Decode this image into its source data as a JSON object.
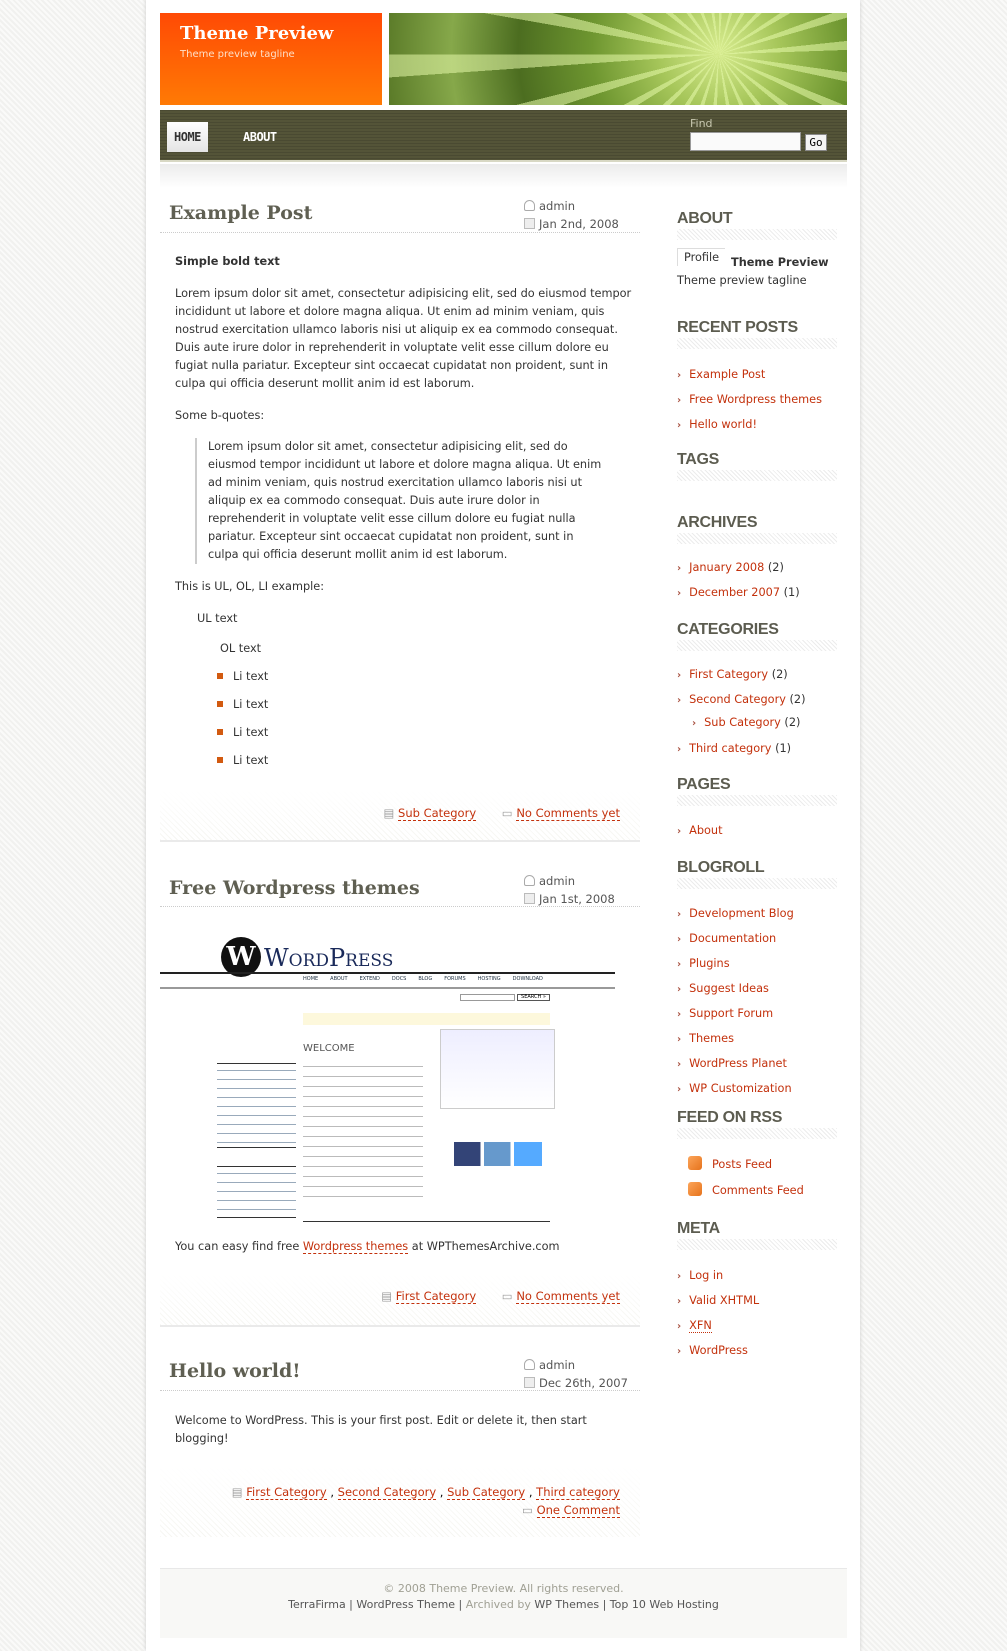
{
  "site": {
    "title": "Theme Preview",
    "tagline": "Theme preview tagline"
  },
  "nav": {
    "items": [
      {
        "label": "HOME",
        "active": true
      },
      {
        "label": "ABOUT"
      }
    ],
    "find_label": "Find",
    "search_value": "",
    "go_label": "Go"
  },
  "colors": {
    "accent": "#ff6a05",
    "link": "#c3310c",
    "nav_bg": "#4e4e35"
  },
  "posts": [
    {
      "title": "Example Post",
      "author": "admin",
      "date": "Jan 2nd, 2008",
      "bold": "Simple bold text",
      "para": "Lorem ipsum dolor sit amet, consectetur adipisicing elit, sed do eiusmod tempor incididunt ut labore et dolore magna aliqua. Ut enim ad minim veniam, quis nostrud exercitation ullamco laboris nisi ut aliquip ex ea commodo consequat. Duis aute irure dolor in reprehenderit in voluptate velit esse cillum dolore eu fugiat nulla pariatur. Excepteur sint occaecat cupidatat non proident, sunt in culpa qui officia deserunt mollit anim id est laborum.",
      "bq_label": "Some b-quotes:",
      "quote": "Lorem ipsum dolor sit amet, consectetur adipisicing elit, sed do eiusmod tempor incididunt ut labore et dolore magna aliqua. Ut enim ad minim veniam, quis nostrud exercitation ullamco laboris nisi ut aliquip ex ea commodo consequat. Duis aute irure dolor in reprehenderit in voluptate velit esse cillum dolore eu fugiat nulla pariatur. Excepteur sint occaecat cupidatat non proident, sunt in culpa qui officia deserunt mollit anim id est laborum.",
      "list_label": "This is UL, OL, LI example:",
      "ul": "UL text",
      "ol": "OL text",
      "li": [
        "Li text",
        "Li text",
        "Li text",
        "Li text"
      ],
      "category": "Sub Category",
      "comments": "No Comments yet"
    },
    {
      "title": "Free Wordpress themes",
      "author": "admin",
      "date": "Jan 1st, 2008",
      "text_before": "You can easy find free ",
      "link": "Wordpress themes",
      "text_after": " at WPThemesArchive.com",
      "image": {
        "logo": "WordPress",
        "nav": [
          "HOME",
          "ABOUT",
          "EXTEND",
          "DOCS",
          "BLOG",
          "FORUMS",
          "HOSTING",
          "DOWNLOAD"
        ],
        "search": "SEARCH »",
        "welcome": "WELCOME"
      },
      "category": "First Category",
      "comments": "No Comments yet"
    },
    {
      "title": "Hello world!",
      "author": "admin",
      "date": "Dec 26th, 2007",
      "text": "Welcome to WordPress. This is your first post. Edit or delete it, then start blogging!",
      "categories": [
        "First Category",
        "Second Category",
        "Sub Category",
        "Third category"
      ],
      "comments": "One Comment"
    }
  ],
  "sidebar": {
    "about": {
      "heading": "ABOUT",
      "tab": "Profile",
      "name": "Theme Preview",
      "tagline": "Theme preview tagline"
    },
    "recent": {
      "heading": "RECENT POSTS",
      "items": [
        "Example Post",
        "Free Wordpress themes",
        "Hello world!"
      ]
    },
    "tags": {
      "heading": "TAGS"
    },
    "archives": {
      "heading": "ARCHIVES",
      "items": [
        {
          "label": "January 2008",
          "count": "(2)"
        },
        {
          "label": "December 2007",
          "count": "(1)"
        }
      ]
    },
    "categories": {
      "heading": "CATEGORIES",
      "items": [
        {
          "label": "First Category",
          "count": "(2)"
        },
        {
          "label": "Second Category",
          "count": "(2)"
        },
        {
          "label": "Sub Category",
          "count": "(2)"
        },
        {
          "label": "Third category",
          "count": "(1)"
        }
      ]
    },
    "pages": {
      "heading": "PAGES",
      "items": [
        "About"
      ]
    },
    "blogroll": {
      "heading": "BLOGROLL",
      "items": [
        "Development Blog",
        "Documentation",
        "Plugins",
        "Suggest Ideas",
        "Support Forum",
        "Themes",
        "WordPress Planet",
        "WP Customization"
      ]
    },
    "feed": {
      "heading": "FEED ON RSS",
      "items": [
        "Posts Feed",
        "Comments Feed"
      ]
    },
    "meta": {
      "heading": "META",
      "items": [
        "Log in",
        "Valid XHTML",
        "XFN",
        "WordPress"
      ]
    }
  },
  "footer": {
    "copyright": "© 2008 Theme Preview. All rights reserved.",
    "links": [
      "TerraFirma",
      "WordPress Theme"
    ],
    "archived_by": "Archived by",
    "wp_themes": "WP Themes",
    "hosting": "Top 10 Web Hosting"
  }
}
